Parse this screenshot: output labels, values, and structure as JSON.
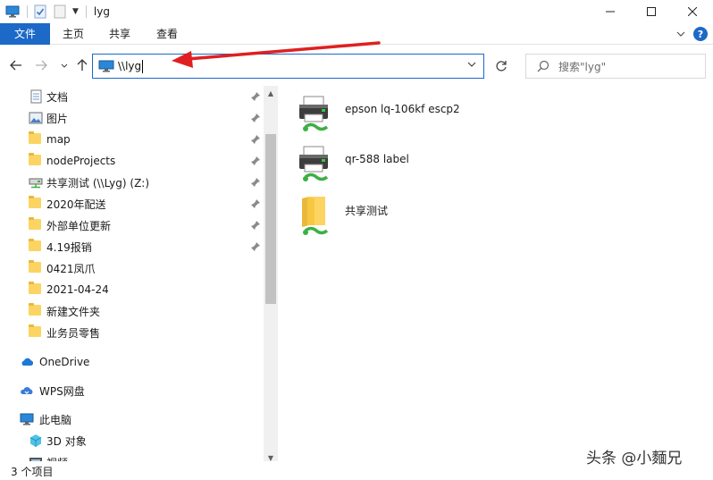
{
  "window": {
    "title": "lyg"
  },
  "ribbon": {
    "tabs": [
      {
        "label": "文件"
      },
      {
        "label": "主页"
      },
      {
        "label": "共享"
      },
      {
        "label": "查看"
      }
    ],
    "help_label": "?"
  },
  "address_bar": {
    "value": "\\\\lyg"
  },
  "search": {
    "placeholder": "搜索\"lyg\""
  },
  "sidebar": {
    "quick_access": [
      {
        "label": "文档",
        "icon": "documents-icon",
        "pinned": true
      },
      {
        "label": "图片",
        "icon": "pictures-icon",
        "pinned": true
      },
      {
        "label": "map",
        "icon": "folder-icon",
        "pinned": true
      },
      {
        "label": "nodeProjects",
        "icon": "folder-icon",
        "pinned": true
      },
      {
        "label": "共享测试 (\\\\Lyg) (Z:)",
        "icon": "network-drive-icon",
        "pinned": true
      },
      {
        "label": "2020年配送",
        "icon": "folder-icon",
        "pinned": true
      },
      {
        "label": "外部单位更新",
        "icon": "folder-icon",
        "pinned": true
      },
      {
        "label": "4.19报销",
        "icon": "folder-icon",
        "pinned": true
      },
      {
        "label": "0421凤爪",
        "icon": "folder-icon",
        "pinned": false
      },
      {
        "label": "2021-04-24",
        "icon": "folder-icon",
        "pinned": false
      },
      {
        "label": "新建文件夹",
        "icon": "folder-icon",
        "pinned": false
      },
      {
        "label": "业务员零售",
        "icon": "folder-icon",
        "pinned": false
      }
    ],
    "roots": [
      {
        "label": "OneDrive",
        "icon": "onedrive-icon"
      },
      {
        "label": "WPS网盘",
        "icon": "wps-cloud-icon"
      },
      {
        "label": "此电脑",
        "icon": "this-pc-icon"
      }
    ],
    "pc_children": [
      {
        "label": "3D 对象",
        "icon": "3d-objects-icon"
      },
      {
        "label": "视频",
        "icon": "videos-icon"
      }
    ]
  },
  "content": {
    "items": [
      {
        "label": "epson lq-106kf escp2",
        "icon": "shared-printer-icon"
      },
      {
        "label": "qr-588 label",
        "icon": "shared-printer-icon"
      },
      {
        "label": "共享测试",
        "icon": "shared-folder-icon"
      }
    ]
  },
  "status_bar": {
    "count": "3 个项目"
  },
  "watermark": "头条 @小麵兄",
  "colors": {
    "accent": "#1c69c8",
    "annotation_arrow": "#e02020",
    "folder": "#fcd462"
  }
}
